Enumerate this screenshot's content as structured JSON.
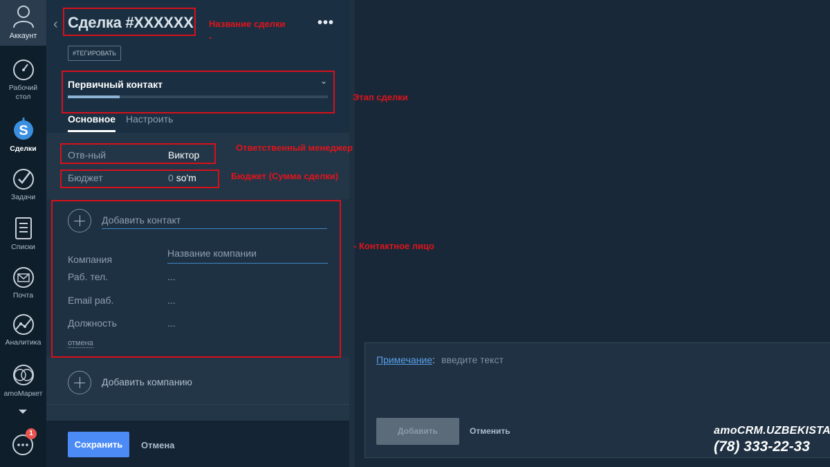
{
  "nav": {
    "account_label": "Аккаунт",
    "items": [
      {
        "label_line1": "Рабочий",
        "label_line2": "стол",
        "icon": "gauge-icon"
      },
      {
        "label_line1": "Сделки",
        "label_line2": "",
        "icon": "dollar-icon"
      },
      {
        "label_line1": "Задачи",
        "label_line2": "",
        "icon": "check-circle-icon"
      },
      {
        "label_line1": "Списки",
        "label_line2": "",
        "icon": "list-icon"
      },
      {
        "label_line1": "Почта",
        "label_line2": "",
        "icon": "mail-icon"
      },
      {
        "label_line1": "Аналитика",
        "label_line2": "",
        "icon": "analytics-icon"
      },
      {
        "label_line1": "amoМаркет",
        "label_line2": "",
        "icon": "market-icon"
      }
    ],
    "chat_badge": "1"
  },
  "deal": {
    "back": "‹",
    "title": "Сделка #XXXXXX",
    "more": "•••",
    "tag_button": "#ТЕГИРОВАТЬ",
    "stage": {
      "name": "Первичный контакт",
      "caret": "⌄",
      "progress_percent": 20
    },
    "tabs": {
      "main": "Основное",
      "settings": "Настроить"
    },
    "responsible": {
      "label": "Отв-ный",
      "value": "Виктор"
    },
    "budget": {
      "label": "Бюджет",
      "value_zero": "0",
      "currency": "so'm"
    },
    "contact": {
      "add_contact_placeholder": "Добавить контакт",
      "company_label": "Компания",
      "company_placeholder": "Название компании",
      "work_phone_label": "Раб. тел.",
      "work_email_label": "Email раб.",
      "position_label": "Должность",
      "empty_value": "...",
      "cancel_link": "отмена"
    },
    "add_company": "Добавить компанию",
    "save_button": "Сохранить",
    "cancel_button": "Отмена"
  },
  "note": {
    "label": "Примечание",
    "colon": ":",
    "placeholder": "введите текст",
    "add_button": "Добавить",
    "cancel_button": "Отменить"
  },
  "brand": {
    "name": "amoCRM.UZBEKISTAN",
    "phone": "(78) 333-22-33"
  },
  "annotations": {
    "deal_name": "Название сделки",
    "deal_name_dash": "-",
    "deal_stage": "Этап сделки",
    "responsible_manager": "Ответственный менеджер",
    "budget": "Бюджет (Сумма сделки)",
    "contact_person": "- Контактное лицо"
  },
  "colors": {
    "accent": "#4c8bf5",
    "annotation": "#e0141c",
    "link": "#5aa0e6"
  }
}
